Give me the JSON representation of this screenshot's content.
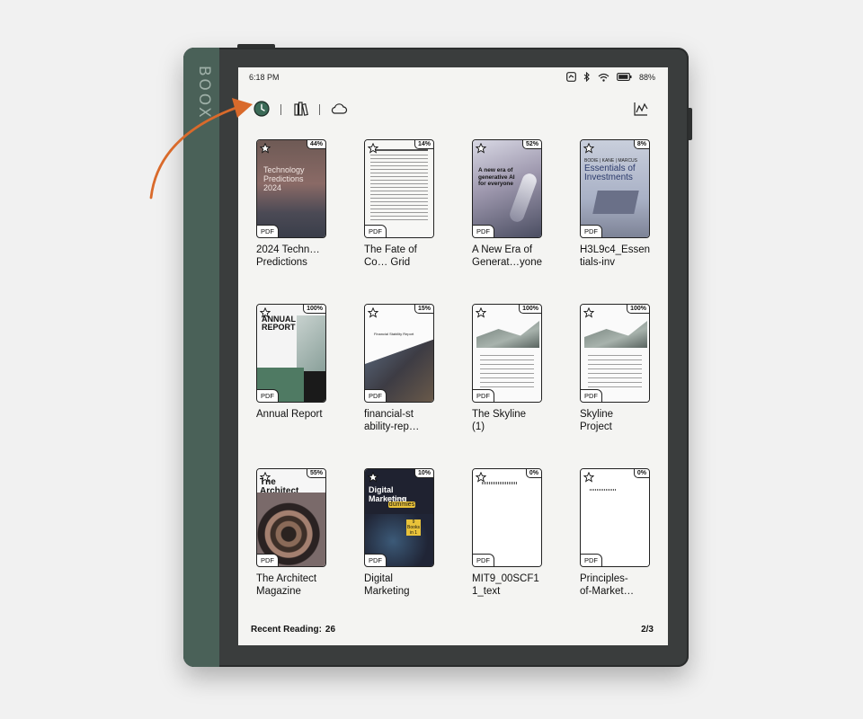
{
  "device": {
    "brand": "BOOX"
  },
  "status_bar": {
    "time": "6:18 PM",
    "battery": "88%"
  },
  "toolbar": {
    "left": [
      "recent-clock-icon",
      "library-books-icon",
      "cloud-icon"
    ],
    "right": "statistics-chart-icon"
  },
  "books": [
    {
      "title": "2024 Techn…\nPredictions",
      "progress": "44%",
      "type": "PDF",
      "cover_text": "Technology Predictions 2024"
    },
    {
      "title": "The Fate of\nCo… Grid",
      "progress": "14%",
      "type": "PDF"
    },
    {
      "title": "A New Era of\nGenerat…yone",
      "progress": "52%",
      "type": "PDF",
      "cover_text": "A new era of generative AI for everyone"
    },
    {
      "title": "H3L9c4_Essen\ntials-inv",
      "progress": "8%",
      "type": "PDF",
      "cover_text": "Essentials of Investments",
      "cover_top": "BODIE | KANE | MARCUS"
    },
    {
      "title": "Annual Report",
      "progress": "100%",
      "type": "PDF",
      "cover_text": "ANNUAL REPORT"
    },
    {
      "title": "financial-st\nability-rep…",
      "progress": "15%",
      "type": "PDF",
      "cover_text": "Financial Stability Report"
    },
    {
      "title": "The Skyline\n(1)",
      "progress": "100%",
      "type": "PDF"
    },
    {
      "title": "Skyline\nProject",
      "progress": "100%",
      "type": "PDF"
    },
    {
      "title": "The Architect\nMagazine",
      "progress": "55%",
      "type": "PDF",
      "cover_text": "The Architect"
    },
    {
      "title": "Digital\nMarketing",
      "progress": "10%",
      "type": "PDF",
      "cover_text": "Digital Marketing",
      "cover_sub": "ALL-IN-ONE",
      "cover_brand": "dümmies",
      "cover_badge": "9 Books in 1"
    },
    {
      "title": "MIT9_00SCF1\n1_text",
      "progress": "0%",
      "type": "PDF"
    },
    {
      "title": "Principles-\nof-Market…",
      "progress": "0%",
      "type": "PDF"
    }
  ],
  "footer": {
    "label": "Recent Reading:",
    "count": "26",
    "page": "2/3"
  },
  "colors": {
    "accent_arrow": "#d96a2b",
    "spine": "#4a6158",
    "frame": "#3a3d3d"
  }
}
